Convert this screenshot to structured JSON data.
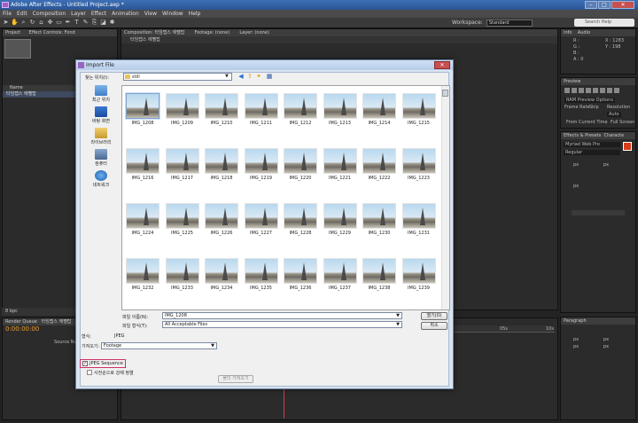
{
  "app": {
    "title": "Adobe After Effects - Untitled Project.aep *",
    "menu": [
      "File",
      "Edit",
      "Composition",
      "Layer",
      "Effect",
      "Animation",
      "View",
      "Window",
      "Help"
    ],
    "workspace_label": "Workspace:",
    "workspace_value": "Standard",
    "search_placeholder": "Search Help"
  },
  "panels": {
    "project_tab": "Project",
    "effect_controls_tab": "Effect Controls: Fond",
    "composition_tab": "Composition: 타임랩스 에펠탑",
    "footage_tab": "Footage: (none)",
    "layer_tab": "Layer: (none)",
    "comp_subtab": "타임랩스 에펠탑",
    "project_col_name": "Name",
    "project_item": "타임랩스 에펠탑",
    "project_footer": "8 bpc",
    "render_queue_tab": "Render Queue",
    "timeline_tab": "타임랩스 에펠탑",
    "timecode": "0:00:00:00",
    "source_name": "Source Name",
    "info_tab": "Info",
    "audio_tab": "Audio",
    "info_rgb": [
      "R :",
      "G :",
      "B :",
      "A : 0"
    ],
    "info_xy": [
      "X : 1283",
      "Y : 198"
    ],
    "preview_tab": "Preview",
    "preview_mode": "RAM Preview Options",
    "preview_frame_rate": "Frame Rate",
    "preview_skip": "Skip",
    "preview_resolution": "Resolution",
    "preview_resolution_value": "Auto",
    "preview_from_current": "From Current Time",
    "preview_full_screen": "Full Screen",
    "effects_tab": "Effects & Presets",
    "character_tab": "Characte",
    "font_name": "Myriad Web Pro",
    "font_style": "Regular",
    "paragraph_tab": "Paragraph",
    "ruler_marks": [
      "0s",
      "05s",
      "10s"
    ],
    "px_label": "px"
  },
  "dialog": {
    "title": "Import File",
    "look_in_label": "찾는 위치(I):",
    "look_in_value": "still",
    "places": [
      "최근 위치",
      "바탕 화면",
      "라이브러리",
      "컴퓨터",
      "네트워크"
    ],
    "files": [
      "IMG_1208",
      "IMG_1209",
      "IMG_1210",
      "IMG_1211",
      "IMG_1212",
      "IMG_1213",
      "IMG_1214",
      "IMG_1215",
      "IMG_1216",
      "IMG_1217",
      "IMG_1218",
      "IMG_1219",
      "IMG_1220",
      "IMG_1221",
      "IMG_1222",
      "IMG_1223",
      "IMG_1224",
      "IMG_1225",
      "IMG_1226",
      "IMG_1227",
      "IMG_1228",
      "IMG_1229",
      "IMG_1230",
      "IMG_1231",
      "IMG_1232",
      "IMG_1233",
      "IMG_1234",
      "IMG_1235",
      "IMG_1236",
      "IMG_1237",
      "IMG_1238",
      "IMG_1239"
    ],
    "selected_index": 0,
    "file_name_label": "파일 이름(N):",
    "file_name_value": "IMG_1208",
    "file_type_label": "파일 형식(T):",
    "file_type_value": "All Acceptable Files",
    "open_button": "열기(O)",
    "cancel_button": "취소",
    "format_label": "형식:",
    "format_value": "JPEG",
    "import_as_label": "가져오기:",
    "import_as_value": "Footage",
    "jpeg_sequence_label": "JPEG Sequence",
    "jpeg_sequence_checked": true,
    "alpha_label": "사전순으로 강제 정렬",
    "import_folder_button": "폴더 가져오기"
  }
}
